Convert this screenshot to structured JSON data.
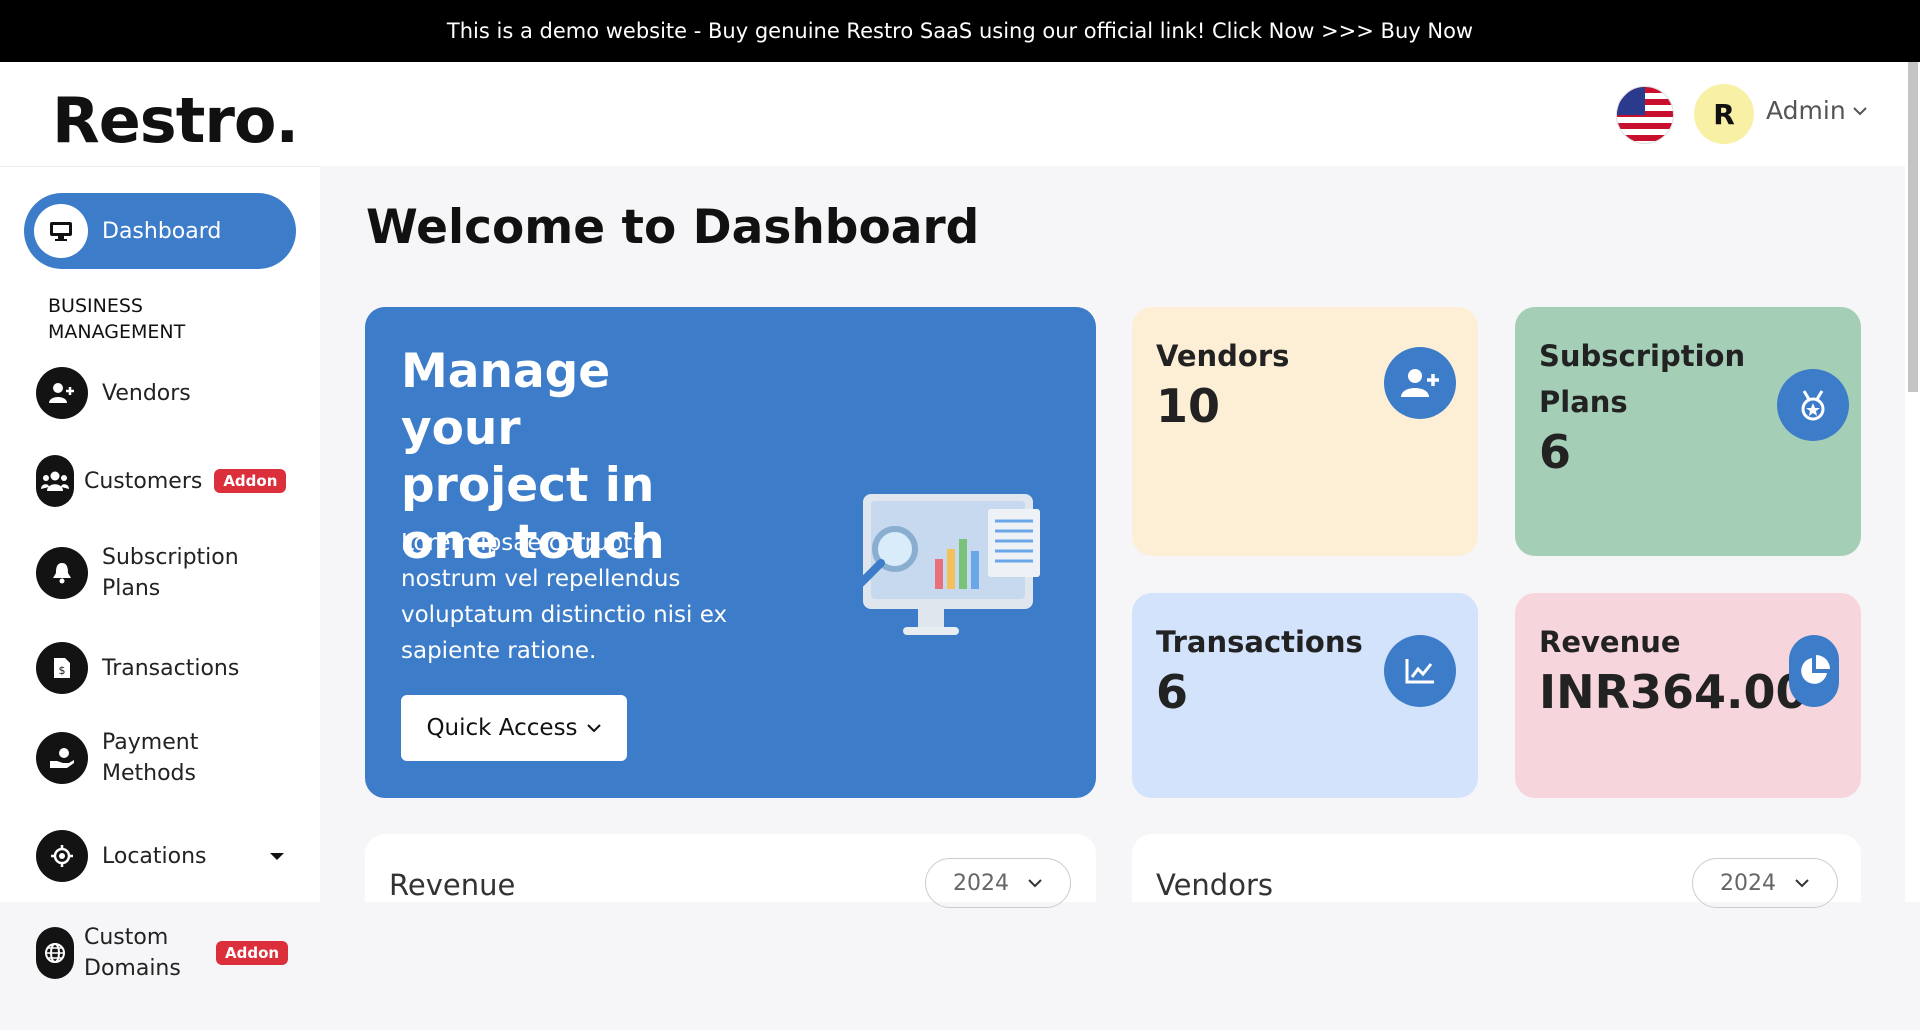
{
  "promo": {
    "text": "This is a demo website - Buy genuine Restro SaaS using our official link! Click Now >>> Buy Now"
  },
  "header": {
    "logo": "Restro.",
    "language_icon": "us-flag-icon",
    "avatar_initial": "R",
    "user_label": "Admin"
  },
  "sidebar": {
    "dashboard_label": "Dashboard",
    "section_label": "BUSINESS MANAGEMENT",
    "items": [
      {
        "label": "Vendors",
        "icon": "add-user-icon"
      },
      {
        "label": "Customers",
        "icon": "users-icon",
        "badge": "Addon"
      },
      {
        "label": "Subscription Plans",
        "icon": "bell-icon"
      },
      {
        "label": "Transactions",
        "icon": "invoice-icon"
      },
      {
        "label": "Payment Methods",
        "icon": "payment-hand-icon"
      },
      {
        "label": "Locations",
        "icon": "location-icon"
      },
      {
        "label": "Custom Domains",
        "icon": "globe-icon",
        "badge": "Addon"
      }
    ]
  },
  "main": {
    "title": "Welcome to Dashboard",
    "hero": {
      "heading": "Manage your project in one touch",
      "description": "Lorem ipsae corrupti nostrum vel repellendus voluptatum distinctio nisi ex sapiente ratione.",
      "button_label": "Quick Access"
    },
    "stats": [
      {
        "label": "Vendors",
        "value": "10",
        "color": "#fdefd6",
        "icon": "add-user-icon"
      },
      {
        "label": "Subscription Plans",
        "value": "6",
        "color": "#a4cfb6",
        "icon": "medal-icon"
      },
      {
        "label": "Transactions",
        "value": "6",
        "color": "#d2e3fb",
        "icon": "line-chart-icon"
      },
      {
        "label": "Revenue",
        "value": "INR364.00",
        "color": "#f6d6dc",
        "icon": "pie-chart-icon"
      }
    ],
    "cards": [
      {
        "title": "Revenue",
        "year": "2024"
      },
      {
        "title": "Vendors",
        "year": "2024"
      }
    ]
  },
  "colors": {
    "accent": "#3d7cc9",
    "addon_badge": "#dc2f3c",
    "promo_bg": "#000000"
  }
}
